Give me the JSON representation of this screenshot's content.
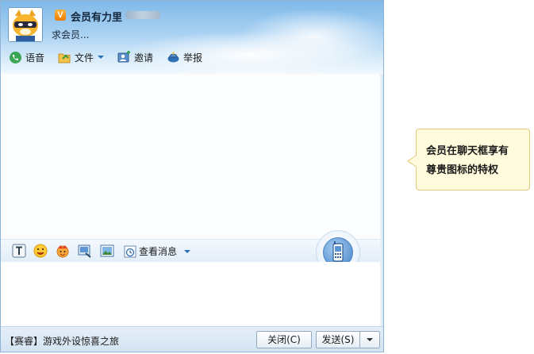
{
  "header": {
    "vip_badge": "V",
    "contact_name": "会员有力里",
    "signature": "求会员..."
  },
  "toolbar": {
    "voice_label": "语音",
    "file_label": "文件",
    "invite_label": "邀请",
    "report_label": "举报"
  },
  "input_toolbar": {
    "history_label": "查看消息"
  },
  "footer": {
    "ad_text": "【赛睿】游戏外设惊喜之旅",
    "close_label": "关闭(C)",
    "send_label": "发送(S)"
  },
  "tooltip": {
    "line1": "会员在聊天框享有",
    "line2": "尊贵图标的特权"
  },
  "colors": {
    "header_sky": "#7fb9e9",
    "vip_orange": "#ee7d00",
    "tooltip_bg": "#fffbdc",
    "border_blue": "#8fb3d4"
  },
  "icons": [
    "avatar-tiger",
    "voice-icon",
    "file-icon",
    "invite-icon",
    "report-icon",
    "font-icon",
    "emoji-icon",
    "magic-emoji-icon",
    "screenshot-icon",
    "image-icon",
    "history-icon",
    "phone-icon"
  ]
}
